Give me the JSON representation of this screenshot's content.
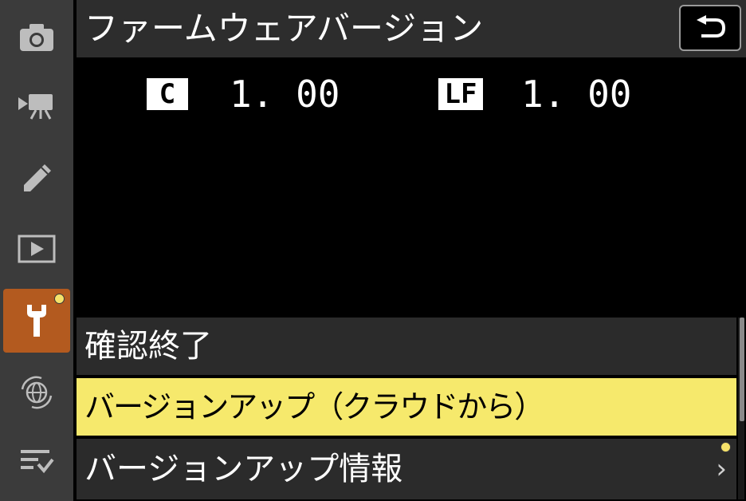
{
  "header": {
    "title": "ファームウェアバージョン",
    "back_icon": "return-arrow-icon"
  },
  "firmware": [
    {
      "badge": "C",
      "version": "1. 00"
    },
    {
      "badge": "LF",
      "version": "1. 00"
    }
  ],
  "sidebar": {
    "items": [
      {
        "icon": "camera-icon",
        "active": false,
        "notification": false
      },
      {
        "icon": "movie-camera-icon",
        "active": false,
        "notification": false
      },
      {
        "icon": "pencil-icon",
        "active": false,
        "notification": false
      },
      {
        "icon": "playback-icon",
        "active": false,
        "notification": false
      },
      {
        "icon": "wrench-icon",
        "active": true,
        "notification": true
      },
      {
        "icon": "network-globe-icon",
        "active": false,
        "notification": false
      },
      {
        "icon": "my-menu-icon",
        "active": false,
        "notification": false
      }
    ]
  },
  "menu": {
    "items": [
      {
        "label": "確認終了",
        "selected": false,
        "has_submenu": false
      },
      {
        "label": "バージョンアップ（クラウドから）",
        "selected": true,
        "has_submenu": false
      },
      {
        "label": "バージョンアップ情報",
        "selected": false,
        "has_submenu": true,
        "notification": true,
        "chevron": "›"
      }
    ]
  },
  "colors": {
    "highlight": "#f6e96c",
    "active_tab": "#b35a1f",
    "notification_dot": "#f6e26a"
  }
}
